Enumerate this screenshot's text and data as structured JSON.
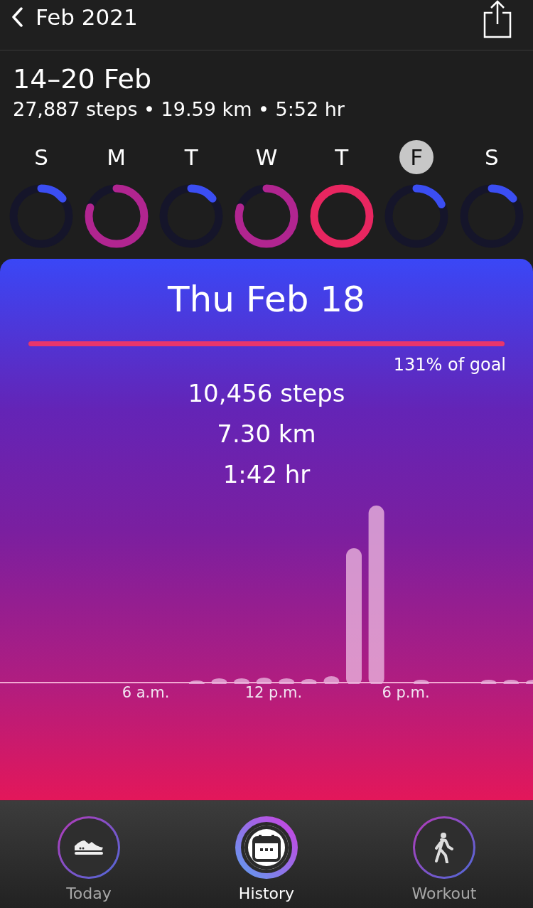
{
  "header": {
    "back_label": "Feb 2021"
  },
  "week": {
    "range": "14–20 Feb",
    "summary": "27,887 steps • 19.59 km • 5:52 hr",
    "days": [
      {
        "letter": "S",
        "today": false,
        "level": 0.14
      },
      {
        "letter": "M",
        "today": false,
        "level": 0.8
      },
      {
        "letter": "T",
        "today": false,
        "level": 0.14
      },
      {
        "letter": "W",
        "today": false,
        "level": 0.8
      },
      {
        "letter": "T",
        "today": false,
        "level": 1
      },
      {
        "letter": "F",
        "today": true,
        "level": 0.18
      },
      {
        "letter": "S",
        "today": false,
        "level": 0.14
      }
    ]
  },
  "day_card": {
    "title": "Thu Feb 18",
    "goal": {
      "level": 1,
      "label": "131% of goal"
    },
    "stats": [
      "10,456 steps",
      "7.30 km",
      "1:42 hr"
    ],
    "axis_labels": [
      "6 a.m.",
      "12 p.m.",
      "6 p.m."
    ]
  },
  "tabs": [
    {
      "label": "Today",
      "kind": "shoe",
      "selected": false
    },
    {
      "label": "History",
      "kind": "calendar",
      "selected": true
    },
    {
      "label": "Workout",
      "kind": "walker",
      "selected": false
    }
  ]
}
